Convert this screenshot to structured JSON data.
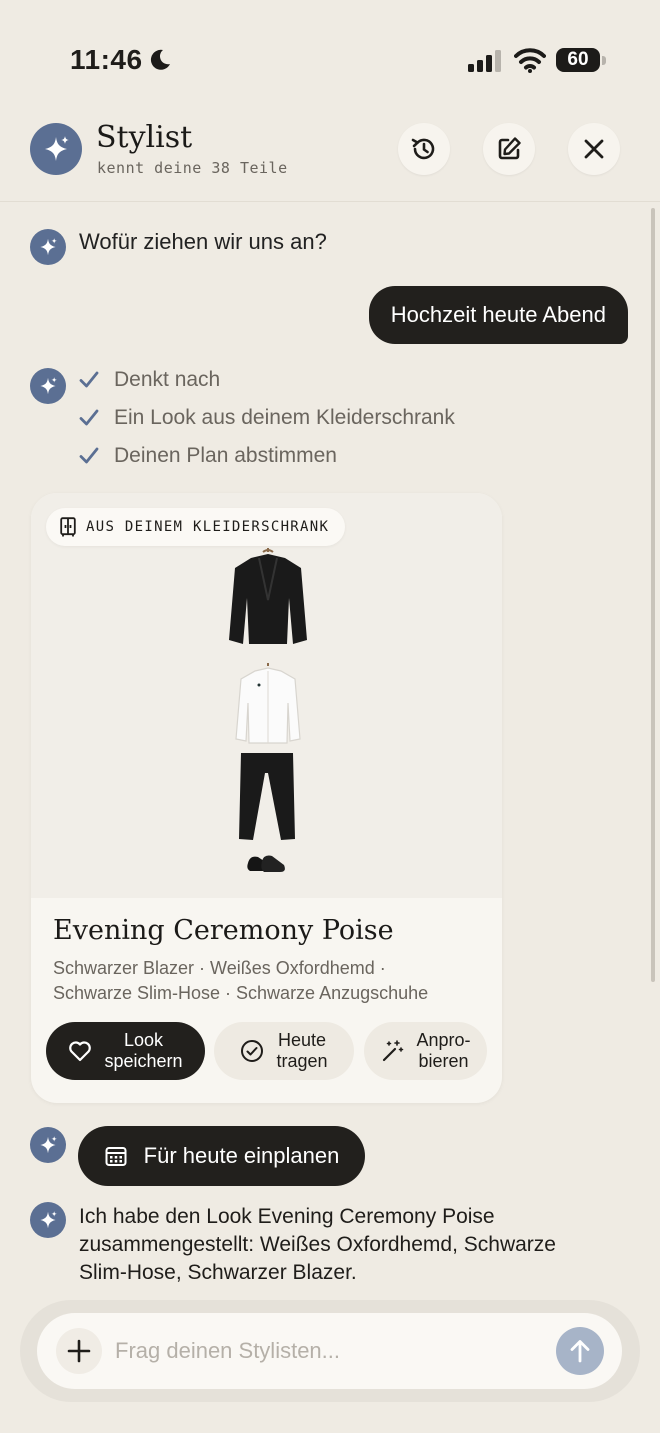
{
  "status_bar": {
    "time": "11:46",
    "battery": "60"
  },
  "header": {
    "title": "Stylist",
    "subtitle": "kennt deine 38 Teile",
    "icons": [
      "history-icon",
      "compose-icon",
      "close-icon"
    ]
  },
  "chat": {
    "assistant_greeting": "Wofür ziehen wir uns an?",
    "user_message": "Hochzeit heute Abend",
    "steps": [
      "Denkt nach",
      "Ein Look aus deinem Kleiderschrank",
      "Deinen Plan abstimmen"
    ],
    "card": {
      "badge": "AUS DEINEM KLEIDERSCHRANK",
      "title": "Evening Ceremony Poise",
      "items_line1": "Schwarzer Blazer · Weißes Oxfordhemd ·",
      "items_line2": "Schwarze Slim-Hose · Schwarze Anzugschuhe",
      "actions": {
        "save_line1": "Look",
        "save_line2": "speichern",
        "wear_line1": "Heute",
        "wear_line2": "tragen",
        "try_line1": "Anpro-",
        "try_line2": "bieren"
      }
    },
    "plan_button": "Für heute einplanen",
    "summary": "Ich habe den Look Evening Ceremony Poise zusammengestellt: Weißes Oxfordhemd, Schwarze Slim-Hose, Schwarzer Blazer."
  },
  "composer": {
    "placeholder": "Frag deinen Stylisten..."
  },
  "colors": {
    "accent": "#5b6f93",
    "dark": "#22201d",
    "background": "#efebe3",
    "send_disabled": "#a7b4c8"
  }
}
